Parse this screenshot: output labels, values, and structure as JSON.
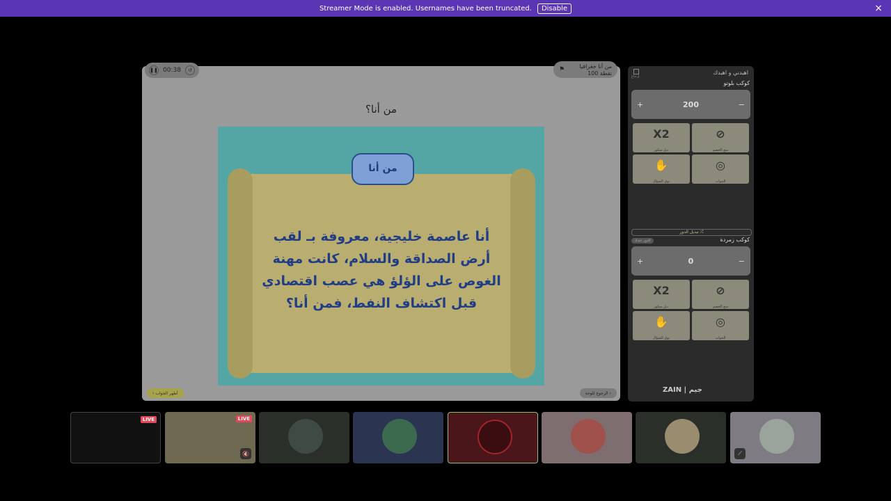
{
  "banner": {
    "text": "Streamer Mode is enabled. Usernames have been truncated.",
    "disable_label": "Disable",
    "close_icon": "×"
  },
  "game": {
    "timer": "00:38",
    "category_title": "من أنا جغرافيا",
    "category_points": "100 نقطة",
    "question_title": "من أنا؟",
    "card_logo": "ﻣﻦ ﺃﻧﺎ",
    "question_text": "أنا عاصمة خليجية، معروفة بـ لقب أرض الصداقة والسلام، كانت مهنة الغوص على الؤلؤ هي عصب اقتصادي قبل اكتشاف النفط، فمن أنا؟",
    "answer_button": "أظهر الجواب",
    "back_button": "الرجوع للوحة"
  },
  "sidebar": {
    "header": "اهبدني و اهبدك",
    "header_sub": "إرجاع",
    "team1": {
      "name": "كوكب بلوتو",
      "score": "200"
    },
    "team2": {
      "name": "كوكب زمردة",
      "score": "0"
    },
    "plus": "+",
    "minus": "−",
    "swap_label": "تبديل الدور ⤮",
    "turn_badge": "الدور عندك",
    "powerups": [
      {
        "icon": "X2",
        "label": "دبل سكور"
      },
      {
        "icon": "⊘",
        "label": "منع الخصم"
      },
      {
        "icon": "✋",
        "label": "نوق السؤال"
      },
      {
        "icon": "◎",
        "label": "الجواب"
      }
    ],
    "sponsor": "ZAIN | ﺟﻴﻢ"
  },
  "participants": {
    "live_label": "LIVE",
    "accent": "#e5475a"
  }
}
